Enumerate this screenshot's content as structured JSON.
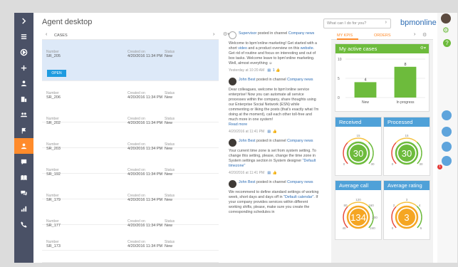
{
  "header": {
    "title": "Agent desktop",
    "search_placeholder": "What can I do for you?",
    "logo_text": "bpmonline"
  },
  "cases": {
    "section_label": "CASES",
    "open_label": "OPEN",
    "col_number": "Number",
    "col_created": "Created on",
    "col_status": "Status",
    "rows": [
      {
        "number": "SR_205",
        "created": "4/20/2016 11:34 PM",
        "status": "New"
      },
      {
        "number": "SR_206",
        "created": "4/20/2016 11:34 PM",
        "status": "New"
      },
      {
        "number": "SR_202",
        "created": "4/20/2016 11:34 PM",
        "status": "New"
      },
      {
        "number": "SR_203",
        "created": "4/20/2016 11:34 PM",
        "status": "New"
      },
      {
        "number": "SR_192",
        "created": "4/20/2016 11:34 PM",
        "status": "New"
      },
      {
        "number": "SR_179",
        "created": "4/20/2016 11:34 PM",
        "status": "New"
      },
      {
        "number": "SR_177",
        "created": "4/20/2016 11:34 PM",
        "status": "New"
      },
      {
        "number": "SR_173",
        "created": "4/20/2016 11:34 PM",
        "status": "New"
      }
    ]
  },
  "feed": {
    "posts": [
      {
        "author": "Supervisor",
        "posted_in": "posted in channel",
        "channel": "Company news",
        "text_a": "Welcome to bpm'online marketing! Get started with a short",
        "link1": "video",
        "text_b": "and a product overview on this",
        "link2": "website",
        "text_c": ". Get rid of routine and focus on interesting and out of box tasks. Welcome leave to bpm'online marketing. Well, almost everything",
        "emoji": "☺",
        "time": "Yesterday at 10:20 AM",
        "likes": "1"
      },
      {
        "author": "John Best",
        "posted_in": "posted in channel",
        "channel": "Company news",
        "text_a": "Dear colleagues, welcome to bpm'online service enterprise! Now you can automate all service processes within the company, share thoughts using our Enterprise Social Network (ESN) while commenting or liking the posts (that's exactly what I'm doing at the moment), call each other toll-free and much more in one system!",
        "read_more": "Read more",
        "time": "4/20/2016 at 11:41 PM"
      },
      {
        "author": "John Best",
        "posted_in": "posted in channel",
        "channel": "Company news",
        "text_a": "Your current time zone is set from system setting. To change this setting, please, change the time zone in System settings section in System designer",
        "link1": "\"Default timezone\"",
        "time": "4/20/2016 at 11:41 PM"
      },
      {
        "author": "John Best",
        "posted_in": "posted in channel",
        "channel": "Company news",
        "text_a": "We recommend to define standard settings of working week, short days and days off in",
        "link1": "\"Default calendar\"",
        "text_b": ". If your company provides services within different working shifts, please, make sure you create the corresponding schedules in"
      }
    ]
  },
  "kpi": {
    "tab_kpis": "MY KPIS",
    "tab_orders": "ORDERS",
    "active_cases_title": "My active cases",
    "received_title": "Received",
    "processed_title": "Processed",
    "avg_call_title": "Average call",
    "avg_rating_title": "Average rating"
  },
  "chart_data": [
    {
      "type": "bar",
      "title": "My active cases",
      "categories": [
        "New",
        "In progress"
      ],
      "values": [
        4,
        8
      ],
      "ylim": [
        0,
        10
      ],
      "yticks": [
        "0",
        "5",
        "10"
      ]
    },
    {
      "type": "gauge",
      "title": "Received",
      "value": 30,
      "min": 0,
      "max": 30,
      "tick_mid": "15"
    },
    {
      "type": "gauge",
      "title": "Processed",
      "value": 30,
      "min": 0,
      "max": 30,
      "tick_mid": "15"
    },
    {
      "type": "gauge",
      "title": "Average call",
      "value": 134,
      "min": 40,
      "max": 240,
      "tick_left": "80",
      "tick_mid": "120",
      "tick_right": "160",
      "tick_far_right": "200"
    },
    {
      "type": "gauge",
      "title": "Average rating",
      "value": 3,
      "min": 0,
      "max": 5,
      "tick_left": "2",
      "tick_mid": "3",
      "tick_right": "4"
    }
  ],
  "right_strip": {
    "help_label": "?",
    "notification_count": "1"
  },
  "colors": {
    "nav_bg": "#4a5166",
    "accent_orange": "#ff8b2b",
    "kpi_green": "#6dbb3c",
    "kpi_blue": "#4fa1d8",
    "link_blue": "#2e6db4",
    "selected_row": "#dde9f8"
  }
}
